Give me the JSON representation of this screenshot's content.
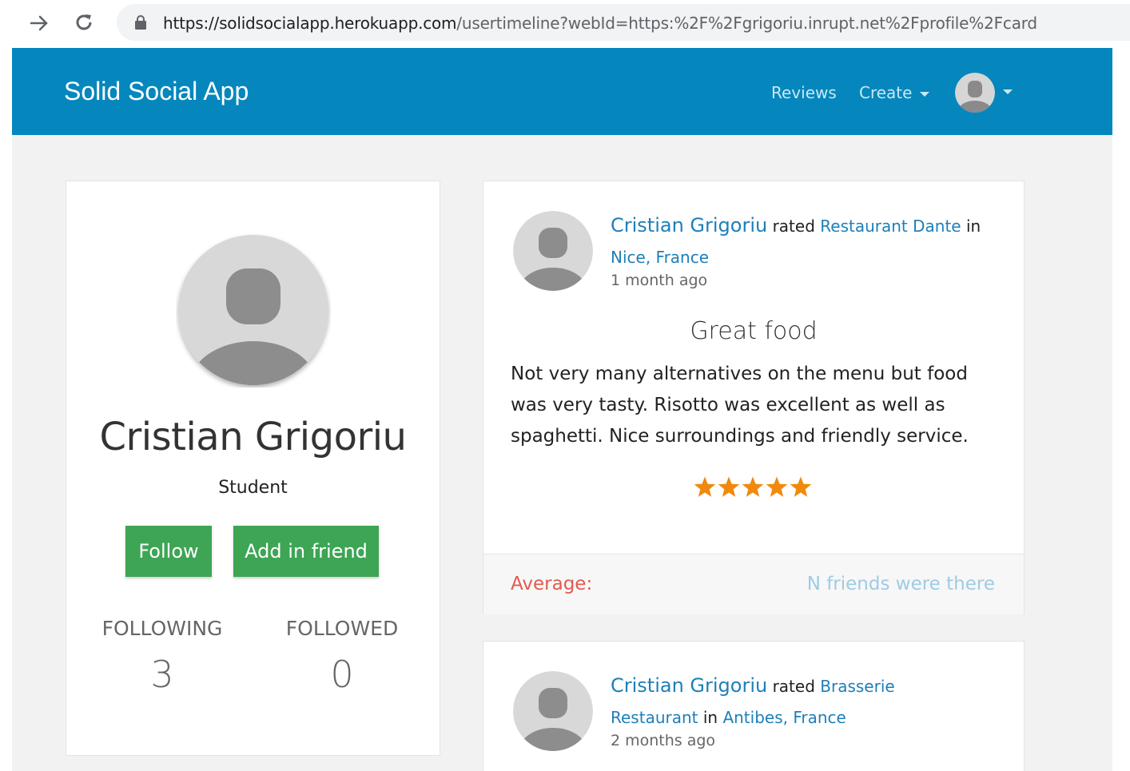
{
  "browser": {
    "url_host": "https://solidsocialapp.herokuapp.com",
    "url_path": "/usertimeline?webId=https:%2F%2Fgrigoriu.inrupt.net%2Fprofile%2Fcard"
  },
  "nav": {
    "brand": "Solid Social App",
    "reviews": "Reviews",
    "create": "Create",
    "color": "#0587bd"
  },
  "profile": {
    "name": "Cristian Grigoriu",
    "role": "Student",
    "follow_label": "Follow",
    "add_friend_label": "Add in friend",
    "following_label": "FOLLOWING",
    "following_count": "3",
    "followed_label": "FOLLOWED",
    "followed_count": "0",
    "button_color": "#3da554"
  },
  "reviews": [
    {
      "author": "Cristian Grigoriu",
      "verb": "rated",
      "place": "Restaurant Dante",
      "prep": "in",
      "location": "Nice, France",
      "time": "1 month ago",
      "title": "Great food",
      "text": "Not very many alternatives on the menu but food was very tasty. Risotto was excellent as well as spaghetti. Nice surroundings and friendly service.",
      "rating": 5,
      "rating_max": 5,
      "average_label": "Average:",
      "friends_label": "N friends were there"
    },
    {
      "author": "Cristian Grigoriu",
      "verb": "rated",
      "place": "Brasserie Restaurant",
      "prep": "in",
      "location": "Antibes, France",
      "time": "2 months ago"
    }
  ],
  "colors": {
    "star": "#f08a0d",
    "link": "#1e7fb8",
    "average": "#e35a4f"
  }
}
